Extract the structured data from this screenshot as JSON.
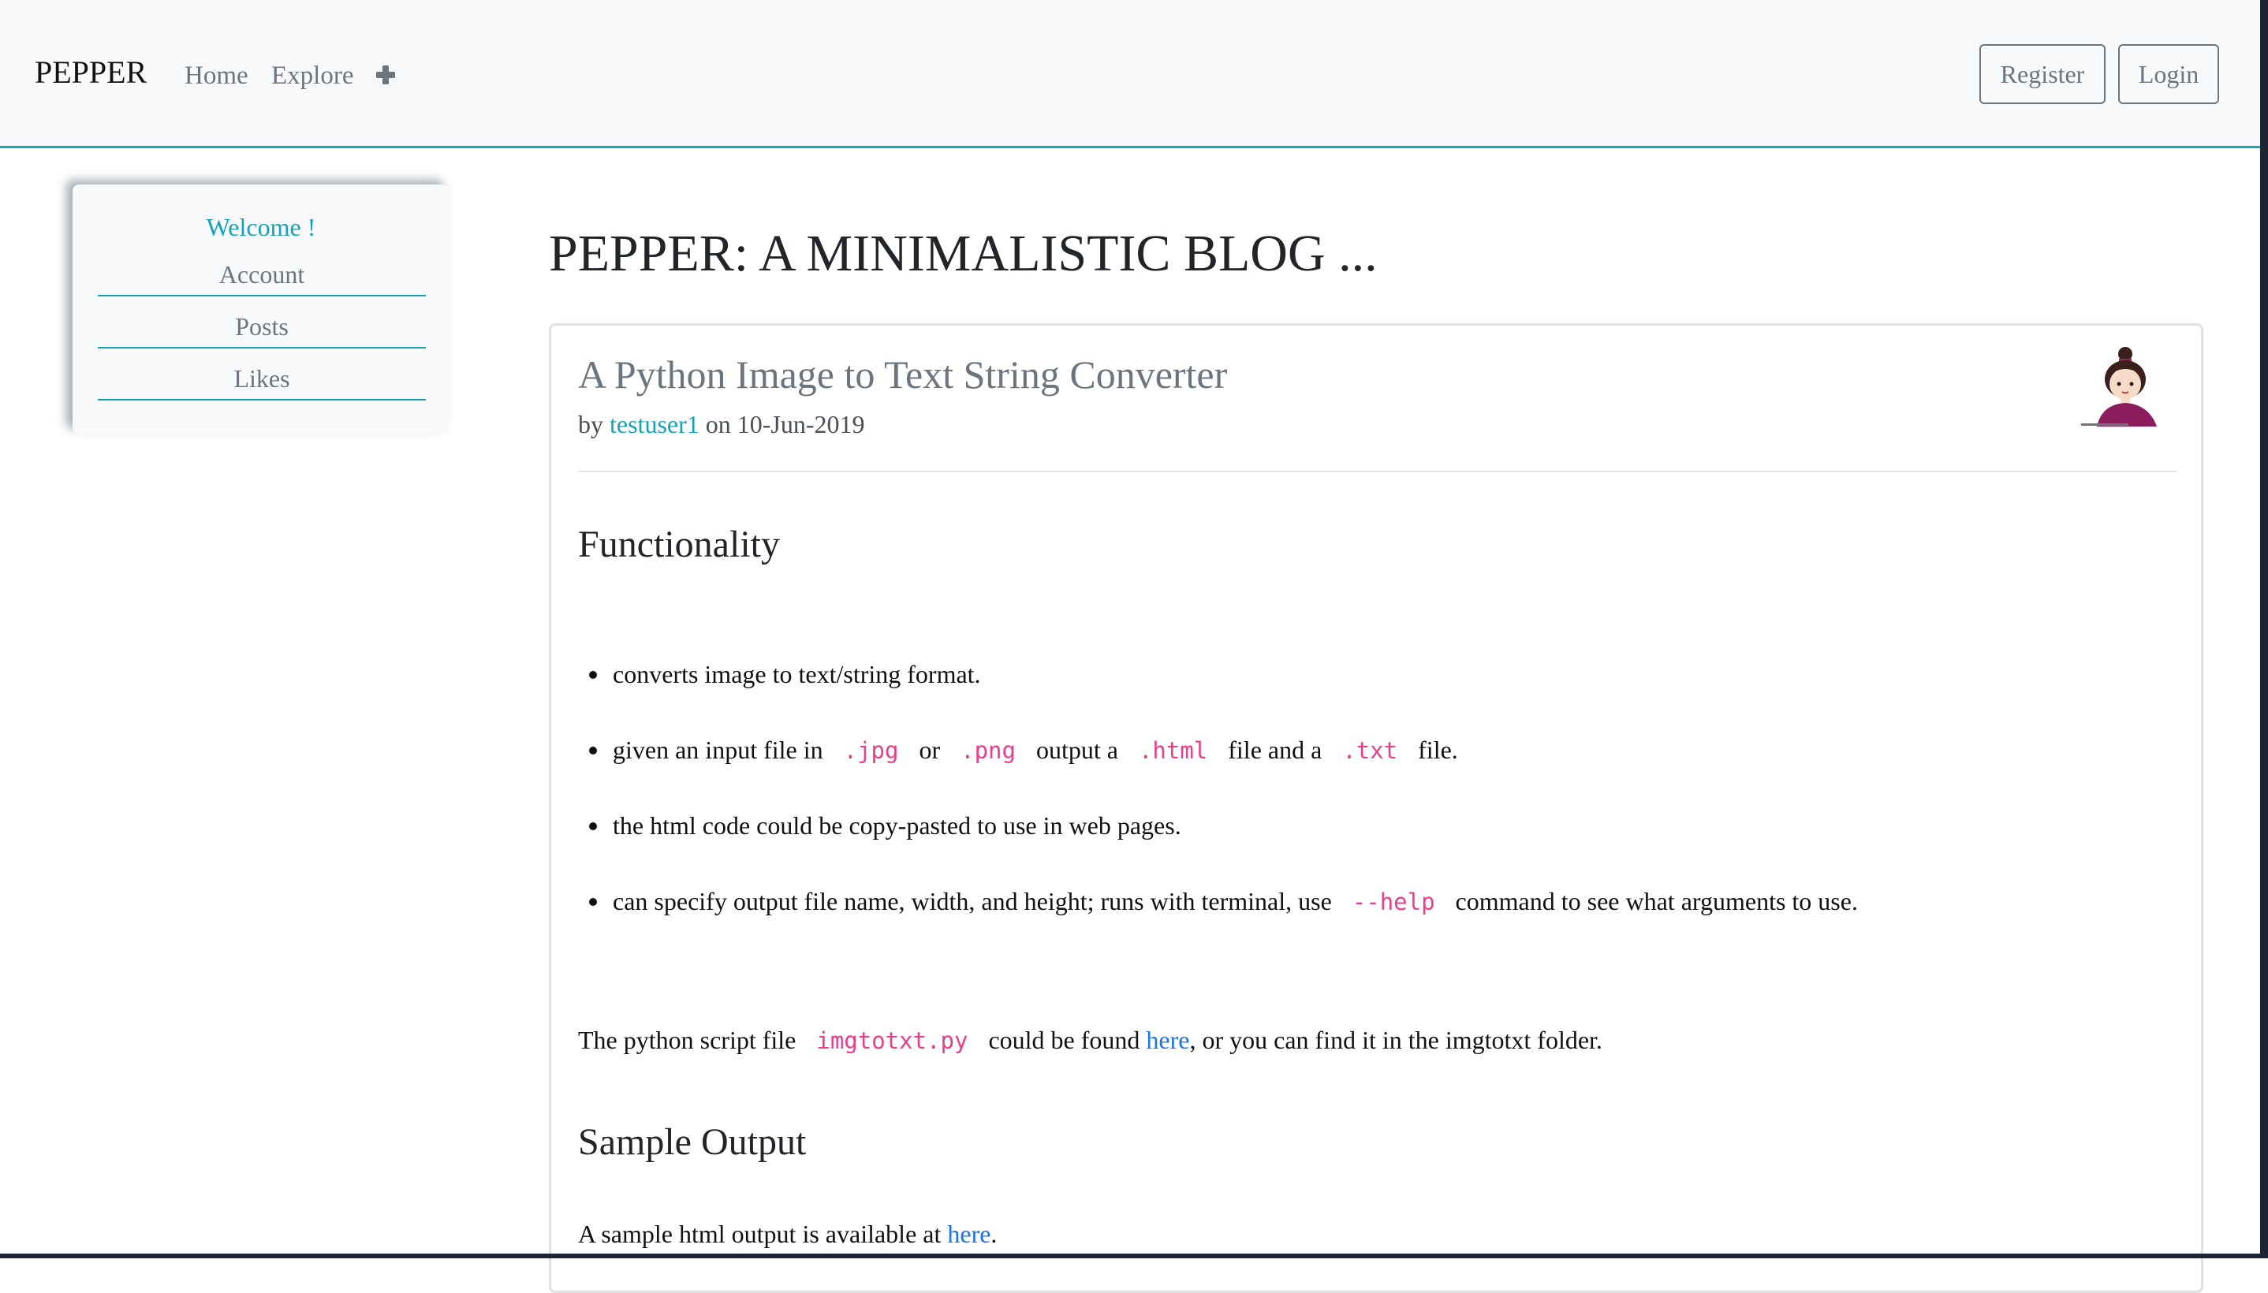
{
  "navbar": {
    "brand": "PEPPER",
    "links": [
      "Home",
      "Explore"
    ],
    "add_icon": "plus-icon",
    "register_label": "Register",
    "login_label": "Login"
  },
  "sidebar": {
    "welcome": "Welcome !",
    "items": [
      "Account",
      "Posts",
      "Likes"
    ]
  },
  "main": {
    "title": "PEPPER: A MINIMALISTIC BLOG ..."
  },
  "post": {
    "title": "A Python Image to Text String Converter",
    "by": "by",
    "author": "testuser1",
    "on": "on",
    "date": "10-Jun-2019",
    "avatar_icon": "avatar-woman-icon",
    "heading_functionality": "Functionality",
    "bullets": {
      "b1": "converts image to text/string format.",
      "b2_pre": "given an input file in",
      "b2_code1": ".jpg",
      "b2_or": "or",
      "b2_code2": ".png",
      "b2_mid": "output a",
      "b2_code3": ".html",
      "b2_mid2": "file and a",
      "b2_code4": ".txt",
      "b2_end": "file.",
      "b3": "the html code could be copy-pasted to use in web pages.",
      "b4_pre": "can specify output file name, width, and height; runs with terminal, use",
      "b4_code": "--help",
      "b4_end": "command to see what arguments to use."
    },
    "script_para": {
      "pre": "The python script file",
      "code": "imgtotxt.py",
      "mid": "could be found",
      "link": "here",
      "end": ", or you can find it in the imgtotxt folder."
    },
    "heading_sample": "Sample Output",
    "sample_para": {
      "pre": "A sample html output is available at",
      "link": "here",
      "end": "."
    }
  },
  "colors": {
    "accent": "#17a2b8",
    "muted": "#6c757d",
    "code": "#e83e8c",
    "link": "#1a73e8"
  }
}
